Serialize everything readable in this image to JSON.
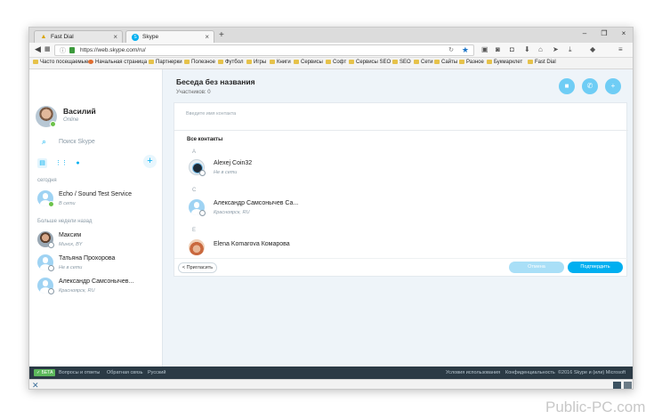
{
  "browser": {
    "tabs": [
      {
        "label": "Fast Dial",
        "close": "×"
      },
      {
        "label": "Skype",
        "close": "×"
      }
    ],
    "new_tab": "+",
    "controls": {
      "minimize": "–",
      "maximize": "❐",
      "close": "×"
    },
    "url": "https://web.skype.com/ru/",
    "bookmarks": [
      "Часто посещаемые",
      "Начальная страница",
      "Партнерки",
      "Полезное",
      "Футбол",
      "Игры",
      "Книги",
      "Сервисы",
      "Софт",
      "Сервисы SEO",
      "SEO",
      "Сети",
      "Сайты",
      "Разное",
      "Букмарклет",
      "Fast Dial"
    ]
  },
  "sidebar": {
    "user": {
      "name": "Василий",
      "status": "Online"
    },
    "search_placeholder": "Поиск Skype",
    "sections": {
      "today": "сегодня",
      "older": "Больше недели назад"
    },
    "contacts": [
      {
        "name": "Echo / Sound Test Service",
        "sub": "В сети",
        "status": "online"
      },
      {
        "name": "Максим",
        "sub": "Минск, BY",
        "status": "offline"
      },
      {
        "name": "Татьяна Прохорова",
        "sub": "Не в сети",
        "status": "offline"
      },
      {
        "name": "Александр Самсонычев...",
        "sub": "Красноярск, RU",
        "status": "offline"
      }
    ]
  },
  "main": {
    "title": "Беседа без названия",
    "members": "Участников: 0",
    "input_placeholder": "Введите имя контакта",
    "all_contacts": "Все контакты",
    "groups": [
      {
        "letter": "A",
        "name": "Alexej Coin32",
        "sub": "Не в сети"
      },
      {
        "letter": "С",
        "name": "Александр Самсонычев Са...",
        "sub": "Красноярск, RU"
      },
      {
        "letter": "E",
        "name": "Elena Komarova Комарова",
        "sub": ""
      }
    ],
    "invite_label": "< Пригласить",
    "cancel_label": "Отмена",
    "confirm_label": "Подтвердить"
  },
  "footer": {
    "badge": "✓ БЕТА",
    "left_links": [
      "Вопросы и ответы",
      "Обратная связь",
      "Русский"
    ],
    "right_links": [
      "Условия использования",
      "Конфиденциальность",
      "©2016 Skype и (или) Microsoft"
    ]
  },
  "watermark": "Public-PC.com"
}
